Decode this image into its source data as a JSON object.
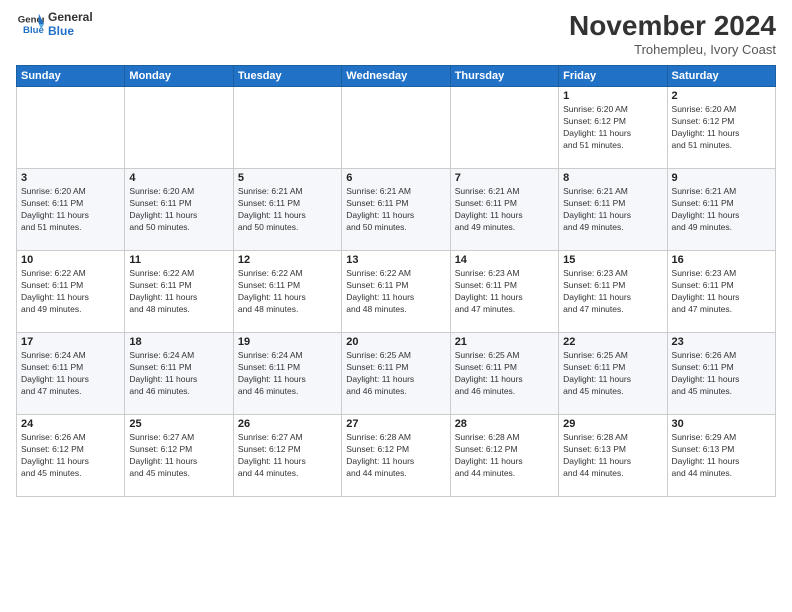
{
  "logo": {
    "line1": "General",
    "line2": "Blue"
  },
  "header": {
    "month": "November 2024",
    "location": "Trohempleu, Ivory Coast"
  },
  "weekdays": [
    "Sunday",
    "Monday",
    "Tuesday",
    "Wednesday",
    "Thursday",
    "Friday",
    "Saturday"
  ],
  "weeks": [
    [
      {
        "day": "",
        "info": ""
      },
      {
        "day": "",
        "info": ""
      },
      {
        "day": "",
        "info": ""
      },
      {
        "day": "",
        "info": ""
      },
      {
        "day": "",
        "info": ""
      },
      {
        "day": "1",
        "info": "Sunrise: 6:20 AM\nSunset: 6:12 PM\nDaylight: 11 hours\nand 51 minutes."
      },
      {
        "day": "2",
        "info": "Sunrise: 6:20 AM\nSunset: 6:12 PM\nDaylight: 11 hours\nand 51 minutes."
      }
    ],
    [
      {
        "day": "3",
        "info": "Sunrise: 6:20 AM\nSunset: 6:11 PM\nDaylight: 11 hours\nand 51 minutes."
      },
      {
        "day": "4",
        "info": "Sunrise: 6:20 AM\nSunset: 6:11 PM\nDaylight: 11 hours\nand 50 minutes."
      },
      {
        "day": "5",
        "info": "Sunrise: 6:21 AM\nSunset: 6:11 PM\nDaylight: 11 hours\nand 50 minutes."
      },
      {
        "day": "6",
        "info": "Sunrise: 6:21 AM\nSunset: 6:11 PM\nDaylight: 11 hours\nand 50 minutes."
      },
      {
        "day": "7",
        "info": "Sunrise: 6:21 AM\nSunset: 6:11 PM\nDaylight: 11 hours\nand 49 minutes."
      },
      {
        "day": "8",
        "info": "Sunrise: 6:21 AM\nSunset: 6:11 PM\nDaylight: 11 hours\nand 49 minutes."
      },
      {
        "day": "9",
        "info": "Sunrise: 6:21 AM\nSunset: 6:11 PM\nDaylight: 11 hours\nand 49 minutes."
      }
    ],
    [
      {
        "day": "10",
        "info": "Sunrise: 6:22 AM\nSunset: 6:11 PM\nDaylight: 11 hours\nand 49 minutes."
      },
      {
        "day": "11",
        "info": "Sunrise: 6:22 AM\nSunset: 6:11 PM\nDaylight: 11 hours\nand 48 minutes."
      },
      {
        "day": "12",
        "info": "Sunrise: 6:22 AM\nSunset: 6:11 PM\nDaylight: 11 hours\nand 48 minutes."
      },
      {
        "day": "13",
        "info": "Sunrise: 6:22 AM\nSunset: 6:11 PM\nDaylight: 11 hours\nand 48 minutes."
      },
      {
        "day": "14",
        "info": "Sunrise: 6:23 AM\nSunset: 6:11 PM\nDaylight: 11 hours\nand 47 minutes."
      },
      {
        "day": "15",
        "info": "Sunrise: 6:23 AM\nSunset: 6:11 PM\nDaylight: 11 hours\nand 47 minutes."
      },
      {
        "day": "16",
        "info": "Sunrise: 6:23 AM\nSunset: 6:11 PM\nDaylight: 11 hours\nand 47 minutes."
      }
    ],
    [
      {
        "day": "17",
        "info": "Sunrise: 6:24 AM\nSunset: 6:11 PM\nDaylight: 11 hours\nand 47 minutes."
      },
      {
        "day": "18",
        "info": "Sunrise: 6:24 AM\nSunset: 6:11 PM\nDaylight: 11 hours\nand 46 minutes."
      },
      {
        "day": "19",
        "info": "Sunrise: 6:24 AM\nSunset: 6:11 PM\nDaylight: 11 hours\nand 46 minutes."
      },
      {
        "day": "20",
        "info": "Sunrise: 6:25 AM\nSunset: 6:11 PM\nDaylight: 11 hours\nand 46 minutes."
      },
      {
        "day": "21",
        "info": "Sunrise: 6:25 AM\nSunset: 6:11 PM\nDaylight: 11 hours\nand 46 minutes."
      },
      {
        "day": "22",
        "info": "Sunrise: 6:25 AM\nSunset: 6:11 PM\nDaylight: 11 hours\nand 45 minutes."
      },
      {
        "day": "23",
        "info": "Sunrise: 6:26 AM\nSunset: 6:11 PM\nDaylight: 11 hours\nand 45 minutes."
      }
    ],
    [
      {
        "day": "24",
        "info": "Sunrise: 6:26 AM\nSunset: 6:12 PM\nDaylight: 11 hours\nand 45 minutes."
      },
      {
        "day": "25",
        "info": "Sunrise: 6:27 AM\nSunset: 6:12 PM\nDaylight: 11 hours\nand 45 minutes."
      },
      {
        "day": "26",
        "info": "Sunrise: 6:27 AM\nSunset: 6:12 PM\nDaylight: 11 hours\nand 44 minutes."
      },
      {
        "day": "27",
        "info": "Sunrise: 6:28 AM\nSunset: 6:12 PM\nDaylight: 11 hours\nand 44 minutes."
      },
      {
        "day": "28",
        "info": "Sunrise: 6:28 AM\nSunset: 6:12 PM\nDaylight: 11 hours\nand 44 minutes."
      },
      {
        "day": "29",
        "info": "Sunrise: 6:28 AM\nSunset: 6:13 PM\nDaylight: 11 hours\nand 44 minutes."
      },
      {
        "day": "30",
        "info": "Sunrise: 6:29 AM\nSunset: 6:13 PM\nDaylight: 11 hours\nand 44 minutes."
      }
    ]
  ]
}
